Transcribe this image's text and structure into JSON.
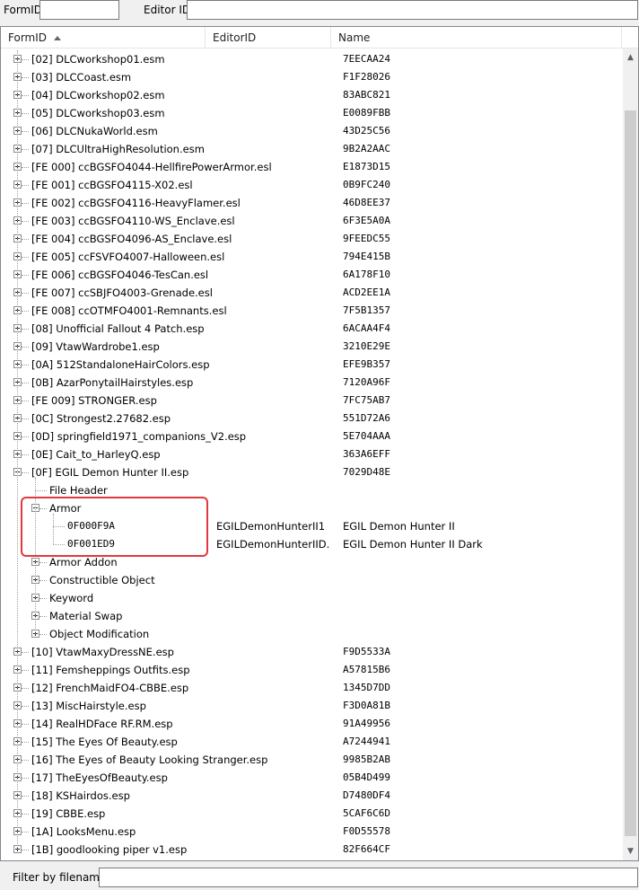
{
  "filters": {
    "formid_label": "FormID",
    "editorid_label": "Editor ID",
    "filename_label": "Filter by filename:",
    "formid_value": "",
    "editorid_value": "",
    "filename_value": ""
  },
  "columns": [
    "FormID",
    "EditorID",
    "Name"
  ],
  "highlight_color": "#e0393e",
  "rows": [
    {
      "level": 0,
      "expander": "plus",
      "formid": "[02] DLCworkshop01.esm",
      "editorid": "",
      "name": "7EECAA24"
    },
    {
      "level": 0,
      "expander": "plus",
      "formid": "[03] DLCCoast.esm",
      "editorid": "",
      "name": "F1F28026"
    },
    {
      "level": 0,
      "expander": "plus",
      "formid": "[04] DLCworkshop02.esm",
      "editorid": "",
      "name": "83ABC821"
    },
    {
      "level": 0,
      "expander": "plus",
      "formid": "[05] DLCworkshop03.esm",
      "editorid": "",
      "name": "E0089FBB"
    },
    {
      "level": 0,
      "expander": "plus",
      "formid": "[06] DLCNukaWorld.esm",
      "editorid": "",
      "name": "43D25C56"
    },
    {
      "level": 0,
      "expander": "plus",
      "formid": "[07] DLCUltraHighResolution.esm",
      "editorid": "",
      "name": "9B2A2AAC"
    },
    {
      "level": 0,
      "expander": "plus",
      "formid": "[FE 000] ccBGSFO4044-HellfirePowerArmor.esl",
      "editorid": "",
      "name": "E1873D15"
    },
    {
      "level": 0,
      "expander": "plus",
      "formid": "[FE 001] ccBGSFO4115-X02.esl",
      "editorid": "",
      "name": "0B9FC240"
    },
    {
      "level": 0,
      "expander": "plus",
      "formid": "[FE 002] ccBGSFO4116-HeavyFlamer.esl",
      "editorid": "",
      "name": "46D8EE37"
    },
    {
      "level": 0,
      "expander": "plus",
      "formid": "[FE 003] ccBGSFO4110-WS_Enclave.esl",
      "editorid": "",
      "name": "6F3E5A0A"
    },
    {
      "level": 0,
      "expander": "plus",
      "formid": "[FE 004] ccBGSFO4096-AS_Enclave.esl",
      "editorid": "",
      "name": "9FEEDC55"
    },
    {
      "level": 0,
      "expander": "plus",
      "formid": "[FE 005] ccFSVFO4007-Halloween.esl",
      "editorid": "",
      "name": "794E415B"
    },
    {
      "level": 0,
      "expander": "plus",
      "formid": "[FE 006] ccBGSFO4046-TesCan.esl",
      "editorid": "",
      "name": "6A178F10"
    },
    {
      "level": 0,
      "expander": "plus",
      "formid": "[FE 007] ccSBJFO4003-Grenade.esl",
      "editorid": "",
      "name": "ACD2EE1A"
    },
    {
      "level": 0,
      "expander": "plus",
      "formid": "[FE 008] ccOTMFO4001-Remnants.esl",
      "editorid": "",
      "name": "7F5B1357"
    },
    {
      "level": 0,
      "expander": "plus",
      "formid": "[08] Unofficial Fallout 4 Patch.esp",
      "editorid": "",
      "name": "6ACAA4F4"
    },
    {
      "level": 0,
      "expander": "plus",
      "formid": "[09] VtawWardrobe1.esp",
      "editorid": "",
      "name": "3210E29E"
    },
    {
      "level": 0,
      "expander": "plus",
      "formid": "[0A] 512StandaloneHairColors.esp",
      "editorid": "",
      "name": "EFE9B357"
    },
    {
      "level": 0,
      "expander": "plus",
      "formid": "[0B] AzarPonytailHairstyles.esp",
      "editorid": "",
      "name": "7120A96F"
    },
    {
      "level": 0,
      "expander": "plus",
      "formid": "[FE 009] STRONGER.esp",
      "editorid": "",
      "name": "7FC75AB7"
    },
    {
      "level": 0,
      "expander": "plus",
      "formid": "[0C] Strongest2.27682.esp",
      "editorid": "",
      "name": "551D72A6"
    },
    {
      "level": 0,
      "expander": "plus",
      "formid": "[0D] springfield1971_companions_V2.esp",
      "editorid": "",
      "name": "5E704AAA"
    },
    {
      "level": 0,
      "expander": "plus",
      "formid": "[0E] Cait_to_HarleyQ.esp",
      "editorid": "",
      "name": "363A6EFF"
    },
    {
      "level": 0,
      "expander": "minus",
      "formid": "[0F] EGIL Demon Hunter II.esp",
      "editorid": "",
      "name": "7029D48E"
    },
    {
      "level": 1,
      "expander": "none",
      "formid": "File Header",
      "editorid": "",
      "name": ""
    },
    {
      "level": 1,
      "expander": "minus",
      "formid": "Armor",
      "editorid": "",
      "name": ""
    },
    {
      "level": 2,
      "expander": "none",
      "formid": "0F000F9A",
      "editorid": "EGILDemonHunterII1",
      "name": "EGIL Demon Hunter II"
    },
    {
      "level": 2,
      "expander": "none",
      "formid": "0F001ED9",
      "editorid": "EGILDemonHunterIID...",
      "name": "EGIL Demon Hunter II Dark"
    },
    {
      "level": 1,
      "expander": "plus",
      "formid": "Armor Addon",
      "editorid": "",
      "name": ""
    },
    {
      "level": 1,
      "expander": "plus",
      "formid": "Constructible Object",
      "editorid": "",
      "name": ""
    },
    {
      "level": 1,
      "expander": "plus",
      "formid": "Keyword",
      "editorid": "",
      "name": ""
    },
    {
      "level": 1,
      "expander": "plus",
      "formid": "Material Swap",
      "editorid": "",
      "name": ""
    },
    {
      "level": 1,
      "expander": "plus",
      "formid": "Object Modification",
      "editorid": "",
      "name": ""
    },
    {
      "level": 0,
      "expander": "plus",
      "formid": "[10] VtawMaxyDressNE.esp",
      "editorid": "",
      "name": "F9D5533A"
    },
    {
      "level": 0,
      "expander": "plus",
      "formid": "[11] Femsheppings Outfits.esp",
      "editorid": "",
      "name": "A57815B6"
    },
    {
      "level": 0,
      "expander": "plus",
      "formid": "[12] FrenchMaidFO4-CBBE.esp",
      "editorid": "",
      "name": "1345D7DD"
    },
    {
      "level": 0,
      "expander": "plus",
      "formid": "[13] MiscHairstyle.esp",
      "editorid": "",
      "name": "F3D0A81B"
    },
    {
      "level": 0,
      "expander": "plus",
      "formid": "[14] RealHDFace RF.RM.esp",
      "editorid": "",
      "name": "91A49956"
    },
    {
      "level": 0,
      "expander": "plus",
      "formid": "[15] The Eyes Of Beauty.esp",
      "editorid": "",
      "name": "A7244941"
    },
    {
      "level": 0,
      "expander": "plus",
      "formid": "[16] The Eyes of Beauty Looking Stranger.esp",
      "editorid": "",
      "name": "9985B2AB"
    },
    {
      "level": 0,
      "expander": "plus",
      "formid": "[17] TheEyesOfBeauty.esp",
      "editorid": "",
      "name": "05B4D499"
    },
    {
      "level": 0,
      "expander": "plus",
      "formid": "[18] KSHairdos.esp",
      "editorid": "",
      "name": "D7480DF4"
    },
    {
      "level": 0,
      "expander": "plus",
      "formid": "[19] CBBE.esp",
      "editorid": "",
      "name": "5CAF6C6D"
    },
    {
      "level": 0,
      "expander": "plus",
      "formid": "[1A] LooksMenu.esp",
      "editorid": "",
      "name": "F0D55578"
    },
    {
      "level": 0,
      "expander": "plus",
      "formid": "[1B] goodlooking piper v1.esp",
      "editorid": "",
      "name": "82F664CF"
    }
  ]
}
